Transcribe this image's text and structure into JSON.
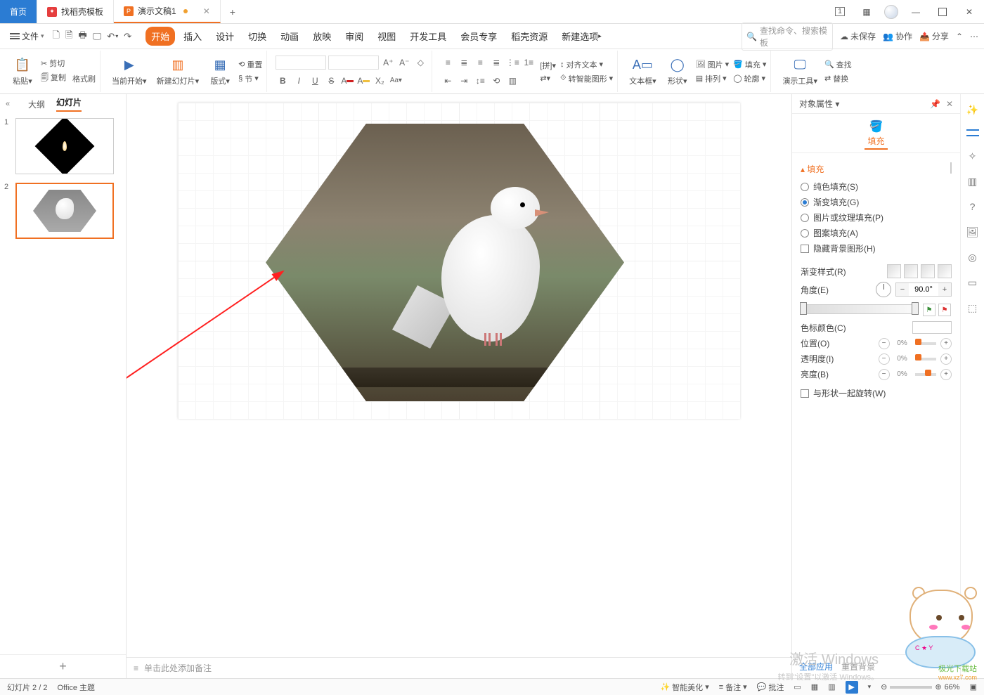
{
  "tabs": {
    "home": "首页",
    "templates": "找稻壳模板",
    "doc": "演示文稿1",
    "newtab_glyph": "+"
  },
  "window": {
    "min": "—",
    "max": "□",
    "close": "✕",
    "layout1": "1",
    "grid": "▦"
  },
  "file_menu": "文件",
  "menus": [
    "开始",
    "插入",
    "设计",
    "切换",
    "动画",
    "放映",
    "审阅",
    "视图",
    "开发工具",
    "会员专享",
    "稻壳资源",
    "新建选项"
  ],
  "search_placeholder": "查找命令、搜索模板",
  "topright": {
    "unsaved": "未保存",
    "coop": "协作",
    "share": "分享"
  },
  "ribbon": {
    "clipboard": {
      "cut": "剪切",
      "copy": "复制",
      "paint": "格式刷",
      "paste": "粘贴"
    },
    "slides": {
      "from_current": "当前开始",
      "new_slide": "新建幻灯片",
      "layout": "版式",
      "reset": "重置",
      "section": "节"
    },
    "font": {
      "font_ph": "",
      "size_ph": "",
      "bold": "B",
      "italic": "I",
      "underline": "U",
      "strike": "S",
      "color": "A",
      "hilite": "A"
    },
    "para": {
      "align_text": "对齐文本",
      "smart": "转智能图形"
    },
    "insert": {
      "textbox": "文本框",
      "shapes": "形状",
      "picture": "图片",
      "arrange": "排列",
      "fill": "填充",
      "outline": "轮廓"
    },
    "tools": {
      "present": "演示工具",
      "find": "查找",
      "replace": "替换"
    }
  },
  "thumbs": {
    "outline": "大纲",
    "slides": "幻灯片"
  },
  "notes_placeholder": "单击此处添加备注",
  "rightpane": {
    "title": "对象属性",
    "tab": "填充",
    "section": "填充",
    "solid": "纯色填充(S)",
    "gradient": "渐变填充(G)",
    "picture": "图片或纹理填充(P)",
    "pattern": "图案填充(A)",
    "hidebg": "隐藏背景图形(H)",
    "gradstyle": "渐变样式(R)",
    "angle": "角度(E)",
    "angle_val": "90.0°",
    "stopcolor": "色标颜色(C)",
    "position": "位置(O)",
    "pos_val": "0%",
    "transparency": "透明度(I)",
    "trans_val": "0%",
    "brightness": "亮度(B)",
    "bright_val": "0%",
    "rotate_with": "与形状一起旋转(W)",
    "apply_all": "全部应用",
    "reset_bg": "重置背景"
  },
  "status": {
    "slide": "幻灯片 2 / 2",
    "theme": "Office 主题",
    "beautify": "智能美化",
    "notes": "备注",
    "comments": "批注",
    "zoom": "66%",
    "activate": "激活 Windows",
    "activate_sub": "转到\"设置\"以激活 Windows。"
  },
  "site": {
    "cn": "极光下载站",
    "url": "www.xz7.com"
  }
}
